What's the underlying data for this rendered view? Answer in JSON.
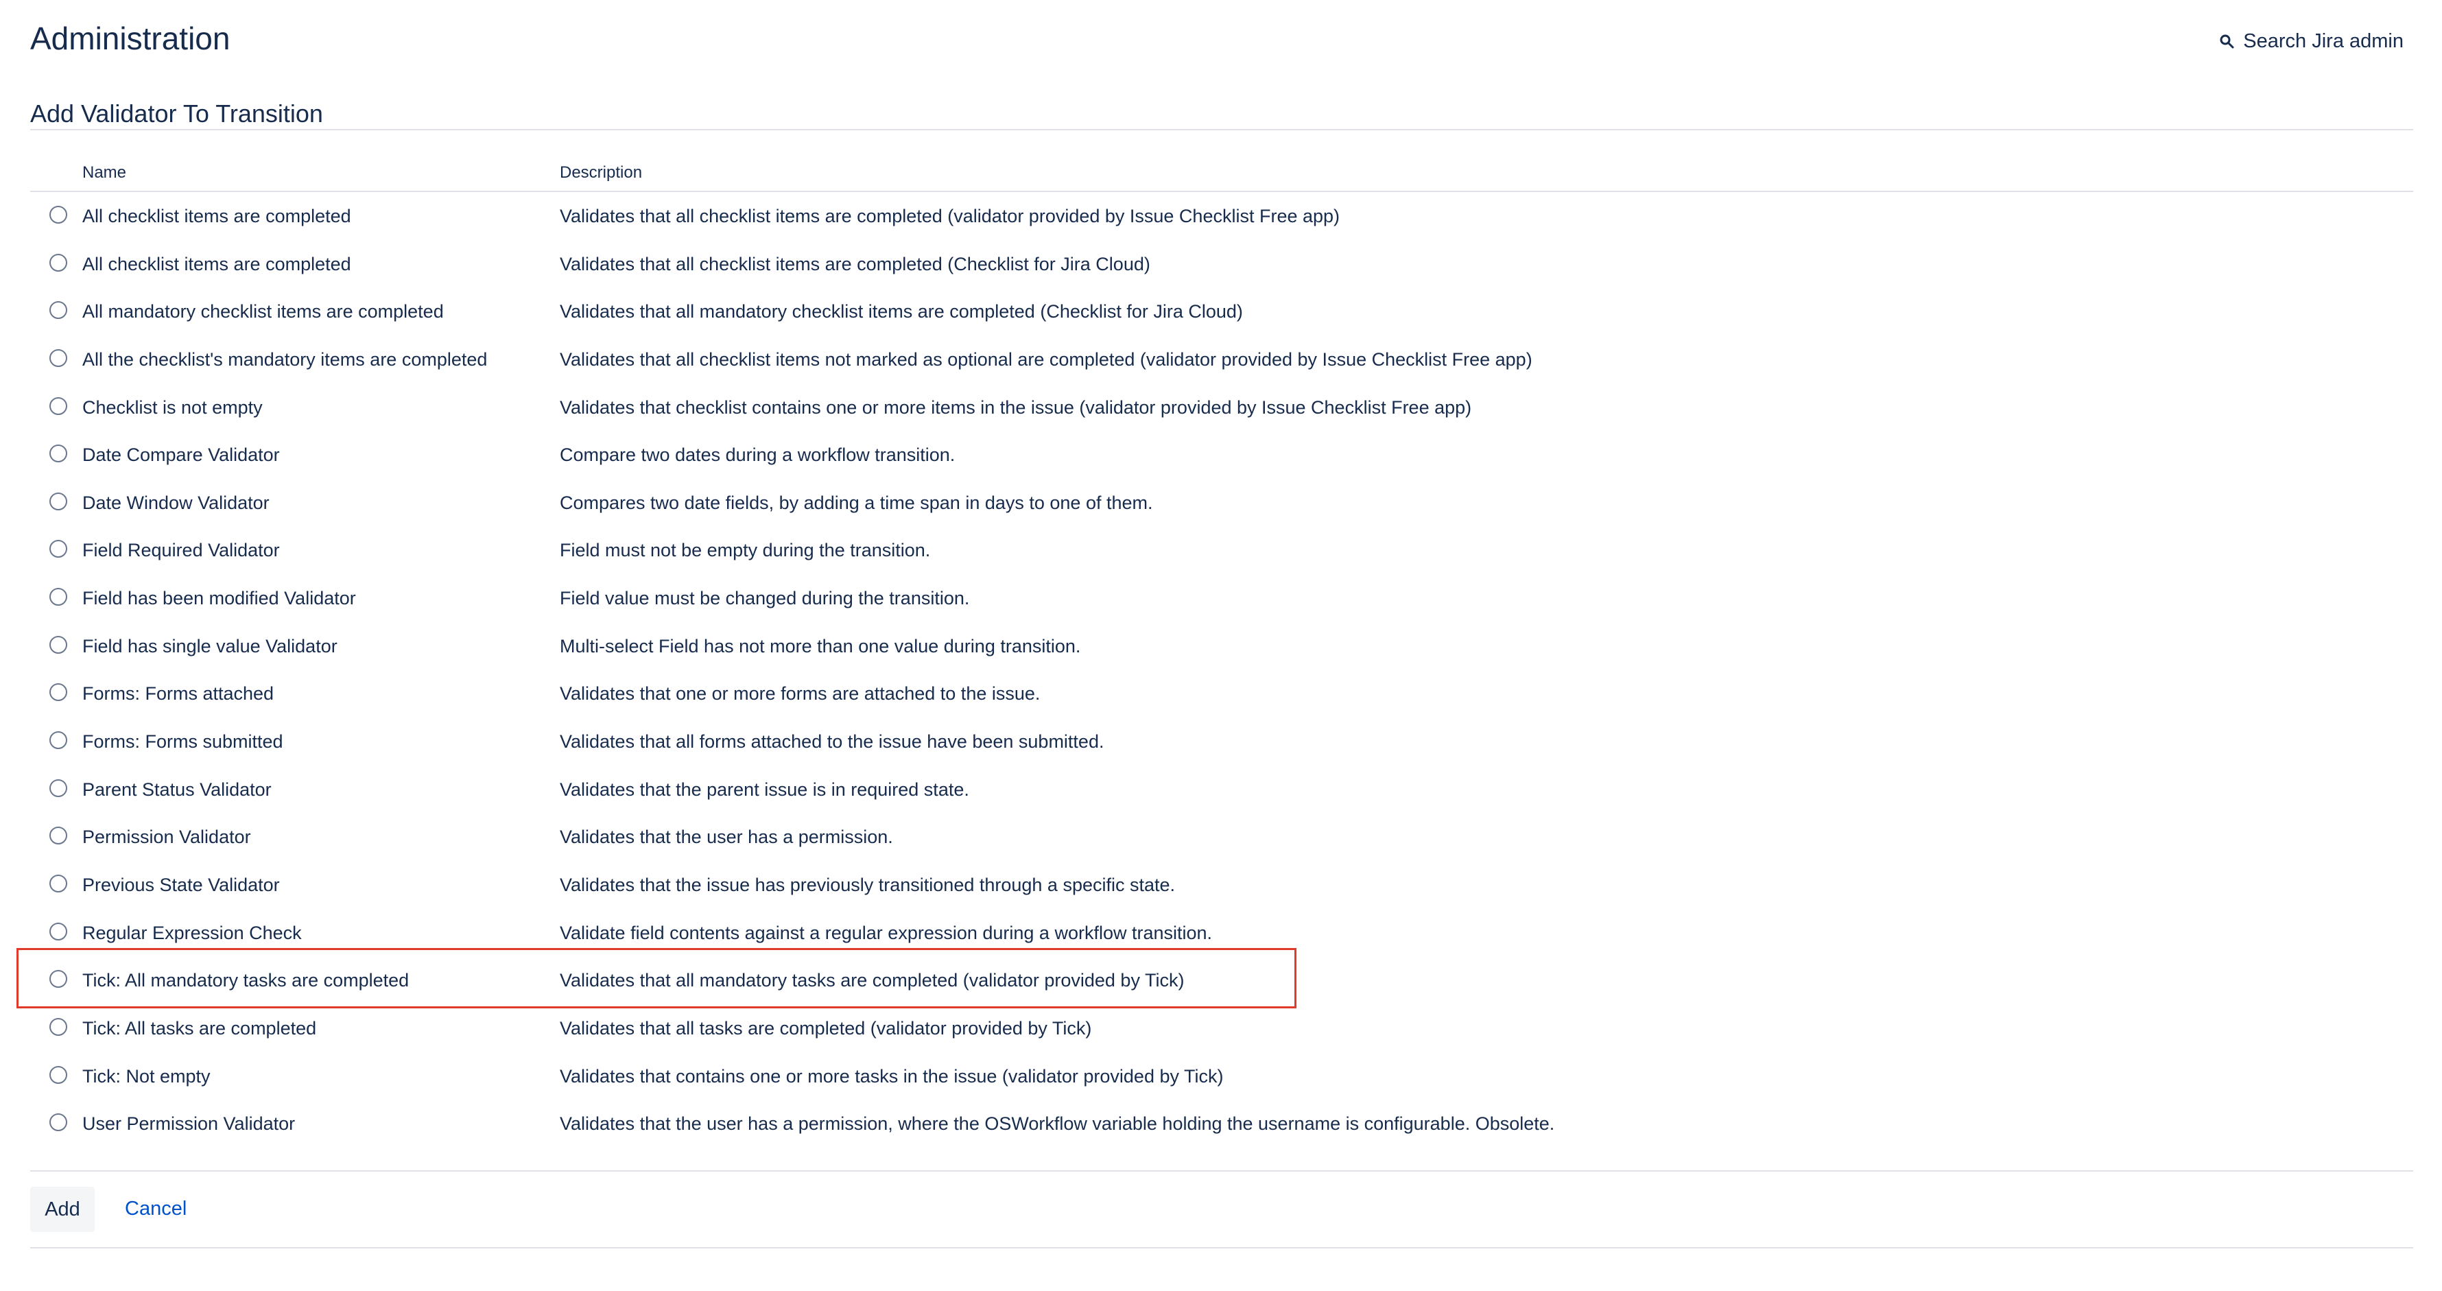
{
  "header": {
    "title": "Administration",
    "search_label": "Search Jira admin",
    "search_icon": "search-icon"
  },
  "section": {
    "title": "Add Validator To Transition"
  },
  "table": {
    "columns": [
      "Name",
      "Description"
    ],
    "rows": [
      {
        "name": "All checklist items are completed",
        "description": "Validates that all checklist items are completed (validator provided by Issue Checklist Free app)"
      },
      {
        "name": "All checklist items are completed",
        "description": "Validates that all checklist items are completed (Checklist for Jira Cloud)"
      },
      {
        "name": "All mandatory checklist items are completed",
        "description": "Validates that all mandatory checklist items are completed (Checklist for Jira Cloud)"
      },
      {
        "name": "All the checklist's mandatory items are completed",
        "description": "Validates that all checklist items not marked as optional are completed (validator provided by Issue Checklist Free app)"
      },
      {
        "name": "Checklist is not empty",
        "description": "Validates that checklist contains one or more items in the issue (validator provided by Issue Checklist Free app)"
      },
      {
        "name": "Date Compare Validator",
        "description": "Compare two dates during a workflow transition."
      },
      {
        "name": "Date Window Validator",
        "description": "Compares two date fields, by adding a time span in days to one of them."
      },
      {
        "name": "Field Required Validator",
        "description": "Field must not be empty during the transition."
      },
      {
        "name": "Field has been modified Validator",
        "description": "Field value must be changed during the transition."
      },
      {
        "name": "Field has single value Validator",
        "description": "Multi-select Field has not more than one value during transition."
      },
      {
        "name": "Forms: Forms attached",
        "description": "Validates that one or more forms are attached to the issue."
      },
      {
        "name": "Forms: Forms submitted",
        "description": "Validates that all forms attached to the issue have been submitted."
      },
      {
        "name": "Parent Status Validator",
        "description": "Validates that the parent issue is in required state."
      },
      {
        "name": "Permission Validator",
        "description": "Validates that the user has a permission."
      },
      {
        "name": "Previous State Validator",
        "description": "Validates that the issue has previously transitioned through a specific state."
      },
      {
        "name": "Regular Expression Check",
        "description": "Validate field contents against a regular expression during a workflow transition."
      },
      {
        "name": "Tick: All mandatory tasks are completed",
        "description": "Validates that all mandatory tasks are completed (validator provided by Tick)"
      },
      {
        "name": "Tick: All tasks are completed",
        "description": "Validates that all tasks are completed (validator provided by Tick)"
      },
      {
        "name": "Tick: Not empty",
        "description": "Validates that contains one or more tasks in the issue (validator provided by Tick)"
      },
      {
        "name": "User Permission Validator",
        "description": "Validates that the user has a permission, where the OSWorkflow variable holding the username is configurable. Obsolete."
      }
    ]
  },
  "actions": {
    "add_label": "Add",
    "cancel_label": "Cancel"
  },
  "colors": {
    "text": "#172b4d",
    "link": "#0052cc",
    "highlight_border": "#e03b2a",
    "divider": "#dfe1e6"
  }
}
